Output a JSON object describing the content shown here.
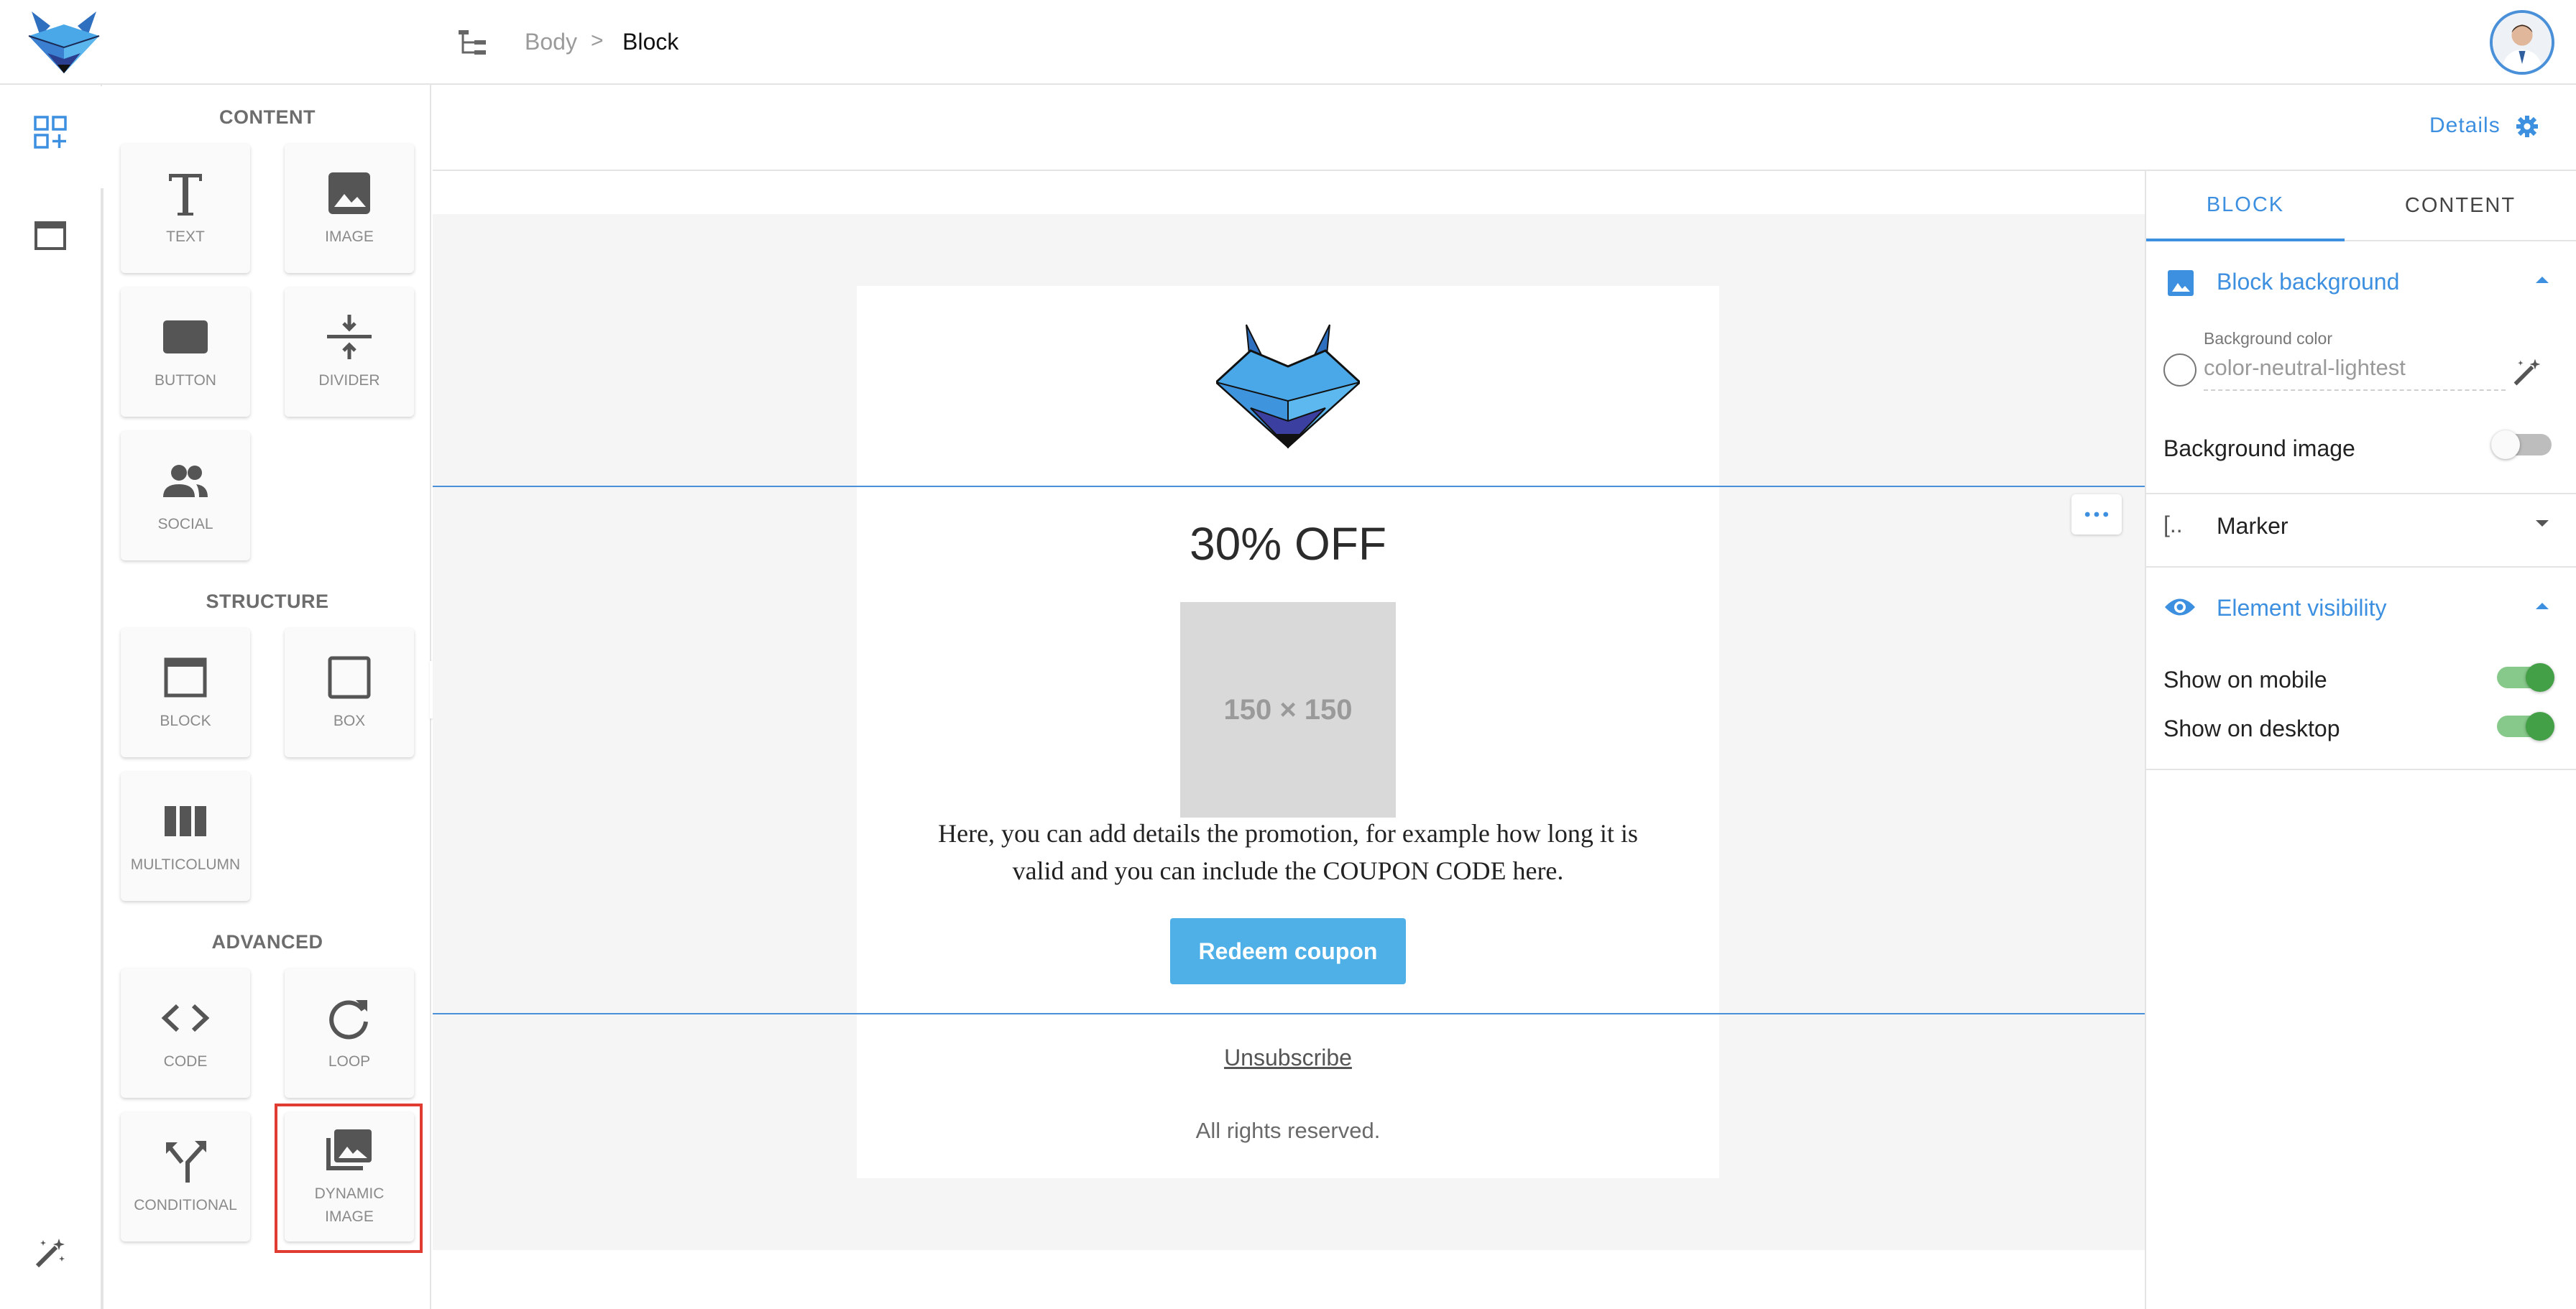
{
  "breadcrumb": {
    "items": [
      "Body",
      "Block"
    ],
    "separator": ">"
  },
  "panel": {
    "sections": {
      "content": "CONTENT",
      "structure": "STRUCTURE",
      "advanced": "ADVANCED"
    },
    "tiles": {
      "text": "TEXT",
      "image": "IMAGE",
      "button": "BUTTON",
      "divider": "DIVIDER",
      "social": "SOCIAL",
      "block": "BLOCK",
      "box": "BOX",
      "multicolumn": "MULTICOLUMN",
      "code": "CODE",
      "loop": "LOOP",
      "conditional": "CONDITIONAL",
      "dynamic_image_1": "DYNAMIC",
      "dynamic_image_2": "IMAGE"
    }
  },
  "canvas": {
    "details_label": "Details",
    "headline": "30% OFF",
    "placeholder": "150 × 150",
    "body_line1": "Here, you can add details  the promotion, for example how long it is",
    "body_line2": "valid and you can include the COUPON CODE here.",
    "cta": "Redeem coupon",
    "unsubscribe": "Unsubscribe",
    "rights": "All rights reserved."
  },
  "right_panel": {
    "tabs": [
      "BLOCK",
      "CONTENT"
    ],
    "block_background": "Block background",
    "bg_color_label": "Background color",
    "bg_color_value": "color-neutral-lightest",
    "bg_image_label": "Background image",
    "bg_image_enabled": false,
    "marker_label": "Marker",
    "visibility_label": "Element visibility",
    "show_mobile": "Show on mobile",
    "show_mobile_enabled": true,
    "show_desktop": "Show on desktop",
    "show_desktop_enabled": true
  },
  "colors": {
    "accent": "#3d8fe0",
    "cta": "#4fb0e8",
    "toggle_on": "#43a047",
    "highlight": "#e03c31"
  }
}
